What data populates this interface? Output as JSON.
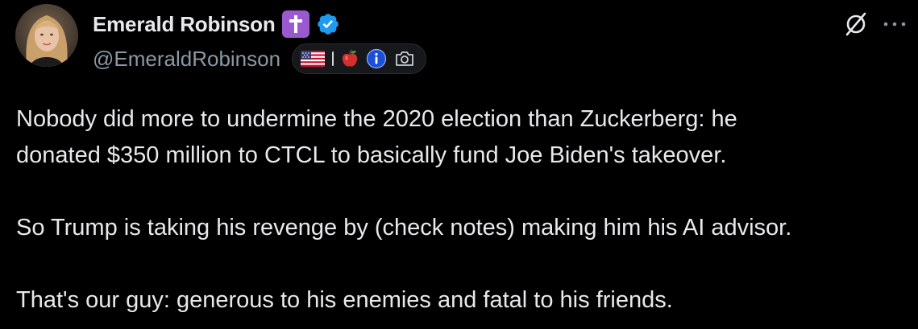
{
  "author": {
    "display_name": "Emerald Robinson",
    "handle": "@EmeraldRobinson",
    "avatar_icon": "profile-photo",
    "name_badges": [
      "latin-cross-icon",
      "verified-badge-icon"
    ]
  },
  "profile_pill": {
    "icons": [
      "us-flag-icon",
      "apple-icon",
      "info-icon",
      "camera-icon"
    ]
  },
  "actions": {
    "icons": [
      "grok-slash-icon",
      "more-options-icon"
    ]
  },
  "tweet": {
    "paragraphs": [
      "Nobody did more to undermine the 2020 election than Zuckerberg: he",
      "donated $350 million to CTCL to basically fund Joe Biden's takeover.",
      "So Trump is taking his revenge by (check notes) making him his AI advisor.",
      "That's our guy: generous to his enemies and fatal to his friends."
    ]
  },
  "colors": {
    "background": "#000000",
    "primary_text": "#e7e9ea",
    "secondary_text": "#8b98a5",
    "verified_blue": "#1d9bf0",
    "cross_badge": "#9b59d0"
  }
}
